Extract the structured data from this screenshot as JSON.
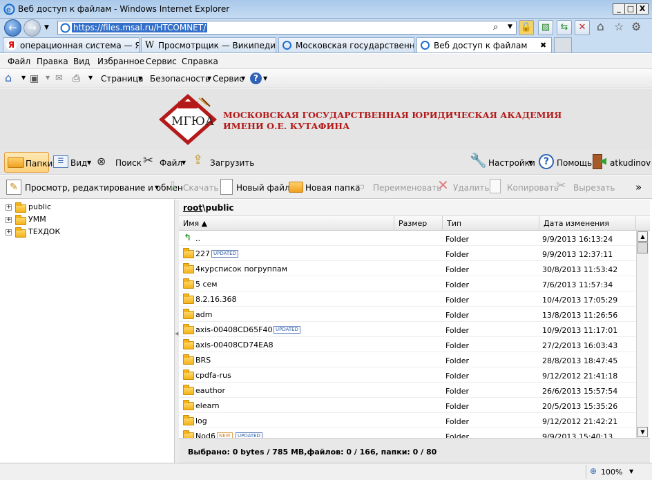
{
  "window": {
    "title": "Веб доступ к файлам - Windows Internet Explorer",
    "minimize": "_",
    "maximize": "□",
    "close": "X"
  },
  "address": {
    "url": "https://files.msal.ru/HTCOMNET/"
  },
  "tabs": [
    {
      "label": "операционная система — Янд…",
      "icon": "yandex-icon"
    },
    {
      "label": "Просмотрщик — Википедия",
      "icon": "wikipedia-icon"
    },
    {
      "label": "Московская государственная …",
      "icon": "ie-page-icon"
    },
    {
      "label": "Веб доступ к файлам",
      "icon": "ie-page-icon",
      "close": "✖"
    }
  ],
  "menu": [
    "Файл",
    "Правка",
    "Вид",
    "Избранное",
    "Сервис",
    "Справка"
  ],
  "command_bar": {
    "page": "Страница",
    "security": "Безопасность",
    "service": "Сервис"
  },
  "banner": {
    "line1": "МОСКОВСКАЯ ГОСУДАРСТВЕННАЯ ЮРИДИЧЕСКАЯ АКАДЕМИЯ",
    "line2": "ИМЕНИ О.Е. КУТАФИНА",
    "logo_text": "МГЮА"
  },
  "toolbar1": {
    "folders": "Папки",
    "view": "Вид",
    "search": "Поиск",
    "file": "Файл",
    "upload": "Загрузить",
    "settings": "Настройки",
    "help": "Помощь",
    "user": "atkudinov"
  },
  "toolbar2": {
    "view_edit": "Просмотр, редактирование и обмен",
    "download": "Скачать",
    "new_file": "Новый файл",
    "new_folder": "Новая папка",
    "rename": "Переименовать",
    "delete": "Удалить",
    "copy": "Копировать",
    "cut": "Вырезать",
    "more": "»"
  },
  "tree": [
    {
      "label": "public"
    },
    {
      "label": "УММ"
    },
    {
      "label": "ТЕХДОК"
    }
  ],
  "breadcrumb": {
    "root": "root",
    "sep": "\\",
    "current": "public"
  },
  "columns": {
    "name": "Имя ▲",
    "size": "Размер",
    "type": "Тип",
    "date": "Дата изменения"
  },
  "rows": [
    {
      "name": "..",
      "type": "Folder",
      "date": "9/9/2013 16:13:24",
      "up": true
    },
    {
      "name": "227",
      "type": "Folder",
      "date": "9/9/2013 12:37:11",
      "badges": [
        "UPDATED"
      ]
    },
    {
      "name": "4курсписок погруппам",
      "type": "Folder",
      "date": "30/8/2013 11:53:42"
    },
    {
      "name": "5 сем",
      "type": "Folder",
      "date": "7/6/2013 11:57:34"
    },
    {
      "name": "8.2.16.368",
      "type": "Folder",
      "date": "10/4/2013 17:05:29"
    },
    {
      "name": "adm",
      "type": "Folder",
      "date": "13/8/2013 11:26:56"
    },
    {
      "name": "axis-00408CD65F40",
      "type": "Folder",
      "date": "10/9/2013 11:17:01",
      "badges": [
        "UPDATED"
      ]
    },
    {
      "name": "axis-00408CD74EA8",
      "type": "Folder",
      "date": "27/2/2013 16:03:43"
    },
    {
      "name": "BRS",
      "type": "Folder",
      "date": "28/8/2013 18:47:45"
    },
    {
      "name": "cpdfa-rus",
      "type": "Folder",
      "date": "9/12/2012 21:41:18"
    },
    {
      "name": "eauthor",
      "type": "Folder",
      "date": "26/6/2013 15:57:54"
    },
    {
      "name": "elearn",
      "type": "Folder",
      "date": "20/5/2013 15:35:26"
    },
    {
      "name": "log",
      "type": "Folder",
      "date": "9/12/2012 21:42:21"
    },
    {
      "name": "Nod6",
      "type": "Folder",
      "date": "9/9/2013 15:40:13",
      "badges": [
        "NEW",
        "UPDATED"
      ]
    }
  ],
  "status": {
    "selected": "Выбрано: 0 bytes / 785 MB,файлов: 0 / 166, папки: 0 / 80"
  },
  "zoom": "100%"
}
